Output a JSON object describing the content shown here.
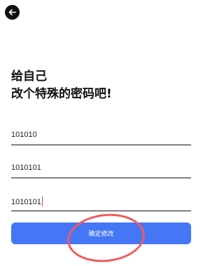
{
  "header": {
    "back_icon": "arrow-left-icon"
  },
  "heading": {
    "line1": "给自己",
    "line2": "改个特殊的密码吧!"
  },
  "fields": [
    {
      "value": "101010"
    },
    {
      "value": "1010101"
    },
    {
      "value": "1010101"
    }
  ],
  "submit": {
    "label": "确定修改",
    "color": "#4476f6"
  },
  "annotation": {
    "color": "#f25a5a"
  }
}
